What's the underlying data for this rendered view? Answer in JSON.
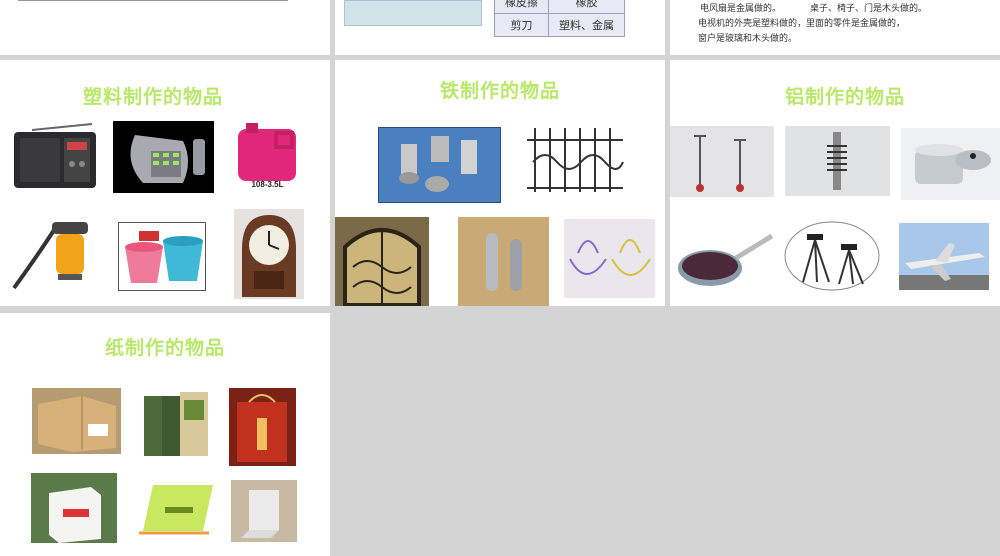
{
  "slides": {
    "plastic": {
      "title": "塑料制作的物品"
    },
    "iron": {
      "title": "铁制作的物品"
    },
    "aluminum": {
      "title": "铝制作的物品"
    },
    "paper": {
      "title": "纸制作的物品"
    }
  },
  "material_table": {
    "rows": [
      {
        "item": "橡皮擦",
        "material": "橡胶"
      },
      {
        "item": "剪刀",
        "material": "塑料、金属"
      }
    ]
  },
  "notes": {
    "line1_a": "电风扇是金属做的。",
    "line1_b": "桌子、椅子、门是木头做的。",
    "line2": "电视机的外壳是塑料做的，里面的零件是金属做的，",
    "line3": "窗户是玻璃和木头做的。"
  },
  "images": {
    "oil_bottle_caption": "108-3.5L"
  },
  "colors": {
    "title_green": "#b9e86a",
    "background": "#d4d4d4"
  }
}
